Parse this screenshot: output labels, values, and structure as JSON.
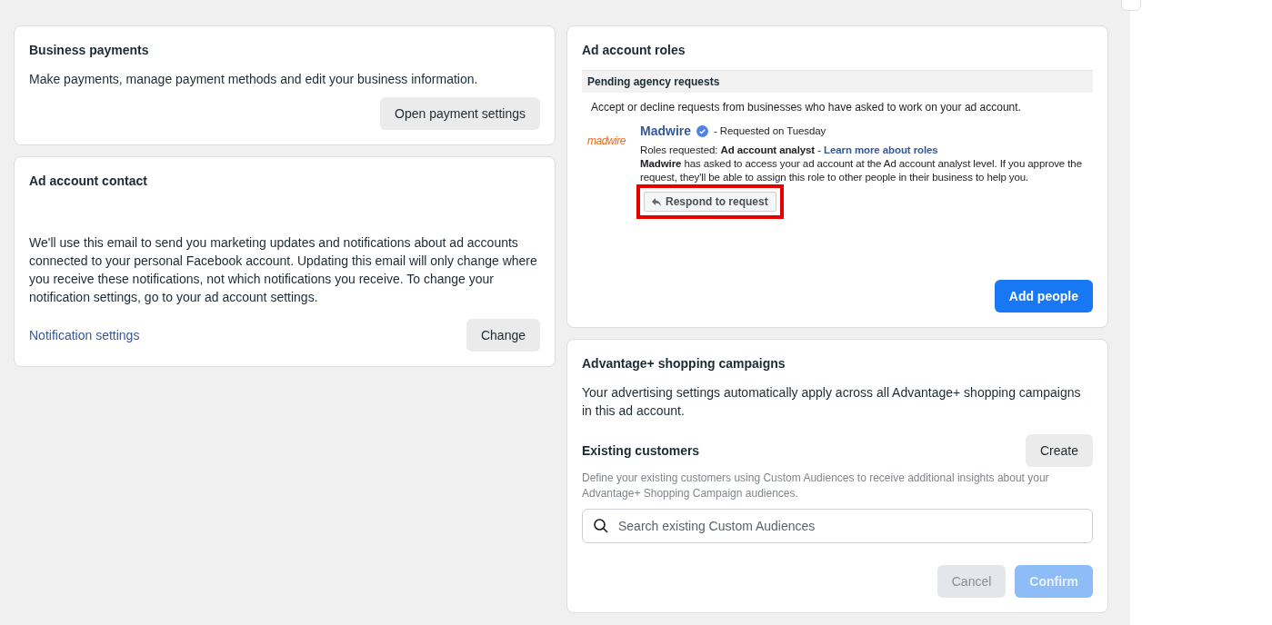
{
  "business_payments": {
    "title": "Business payments",
    "description": "Make payments, manage payment methods and edit your business information.",
    "button": "Open payment settings"
  },
  "ad_account_contact": {
    "title": "Ad account contact",
    "description": "We'll use this email to send you marketing updates and notifications about ad accounts connected to your personal Facebook account. Updating this email will only change where you receive these notifications, not which notifications you receive. To change your notification settings, go to your ad account settings.",
    "link": "Notification settings",
    "button": "Change"
  },
  "ad_account_roles": {
    "title": "Ad account roles",
    "section_title": "Pending agency requests",
    "intro": "Accept or decline requests from businesses who have asked to work on your ad account.",
    "request": {
      "logo": "madwire",
      "business": "Madwire",
      "verified": true,
      "requested": "- Requested on Tuesday",
      "roles": "Roles requested: **Ad account analyst** -",
      "roles_link": "Learn more about roles",
      "details": "**Madwire** has asked to access your ad account at the Ad account analyst level. If you approve the request, they'll be able to assign this role to other people in their business to help you.",
      "button": "Respond to request",
      "highlighted": true
    },
    "button": "Add people"
  },
  "advantage": {
    "title": "Advantage+ shopping campaigns",
    "description": "Your advertising settings automatically apply across all Advantage+ shopping campaigns in this ad account.",
    "subtitle": "Existing customers",
    "create_button": "Create",
    "hint": "Define your existing customers using Custom Audiences to receive additional insights about your Advantage+ Shopping Campaign audiences.",
    "search": {
      "placeholder": "Search existing Custom Audiences"
    },
    "buttons": [
      {
        "label": "Cancel",
        "kind": "secondary",
        "disabled": true
      },
      {
        "label": "Confirm",
        "kind": "primary",
        "disabled": true
      }
    ]
  }
}
